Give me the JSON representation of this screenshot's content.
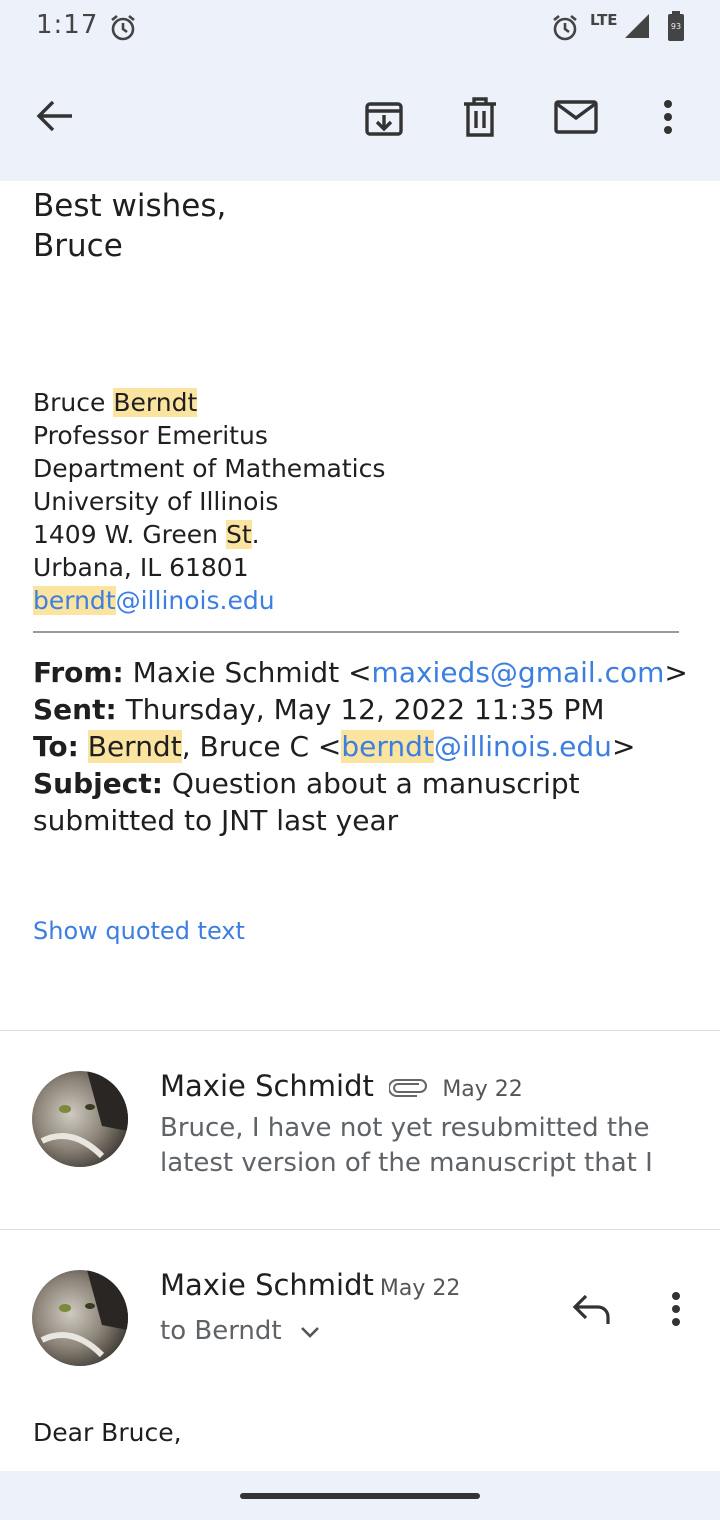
{
  "status_bar": {
    "time": "1:17",
    "network": "LTE",
    "battery": "93"
  },
  "toolbar": {
    "back": "back-arrow-icon",
    "archive": "archive-icon",
    "delete": "trash-icon",
    "mark_unread": "mail-icon",
    "more": "more-vert-icon"
  },
  "message_tail": {
    "closing_line1": "Best wishes,",
    "closing_line2": "Bruce"
  },
  "signature": {
    "first_name": "Bruce ",
    "last_name": "Berndt",
    "title": "Professor Emeritus",
    "department": "Department of Mathematics",
    "university": "University of Illinois",
    "street_pre": "1409 W. Green ",
    "street_hl": "St",
    "street_post": ".",
    "city": "Urbana, IL 61801",
    "email_user": "berndt",
    "email_domain": "@illinois.edu"
  },
  "quoted_header": {
    "from_label": "From:",
    "from_name": " Maxie Schmidt <",
    "from_email": "maxieds@gmail.com",
    "from_close": ">",
    "sent_label": "Sent:",
    "sent_value": " Thursday, May 12, 2022 11:35 PM",
    "to_label": "To:",
    "to_hl": "Berndt",
    "to_mid": ", Bruce C <",
    "to_email_user": "berndt",
    "to_email_domain": "@illinois.edu",
    "to_close": ">",
    "subject_label": "Subject:",
    "subject_line1": " Question about a manuscript",
    "subject_line2": "submitted to JNT last year"
  },
  "show_quoted": "Show quoted text",
  "thread": [
    {
      "sender": "Maxie Schmidt",
      "date": "May 22",
      "snippet_line1": "Bruce, I have not yet resubmitted the",
      "snippet_line2": "latest version of the manuscript that I"
    },
    {
      "sender": "Maxie Schmidt",
      "date": "May 22",
      "to_line": "to Berndt",
      "body_start": "Dear Bruce,"
    }
  ],
  "colors": {
    "bar_bg": "#edf1f9",
    "link": "#3d7ee1",
    "highlight": "#fbe3a0"
  }
}
